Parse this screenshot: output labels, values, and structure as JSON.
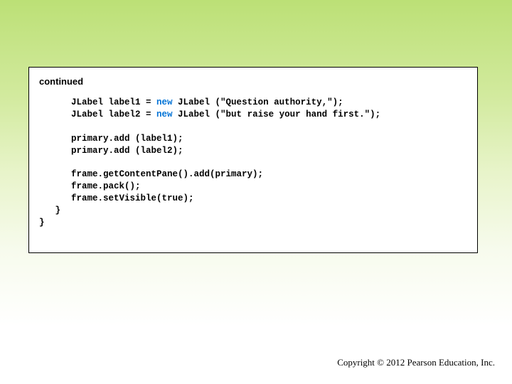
{
  "panel": {
    "continued_label": "continued"
  },
  "code": {
    "l1a": "      JLabel label1 = ",
    "l1kw": "new",
    "l1b": " JLabel (\"Question authority,\");",
    "l2a": "      JLabel label2 = ",
    "l2kw": "new",
    "l2b": " JLabel (\"but raise your hand first.\");",
    "l3": "      primary.add (label1);",
    "l4": "      primary.add (label2);",
    "l5": "      frame.getContentPane().add(primary);",
    "l6": "      frame.pack();",
    "l7": "      frame.setVisible(true);",
    "l8": "   }",
    "l9": "}"
  },
  "footer": {
    "copyright": "Copyright © 2012 Pearson Education, Inc."
  }
}
